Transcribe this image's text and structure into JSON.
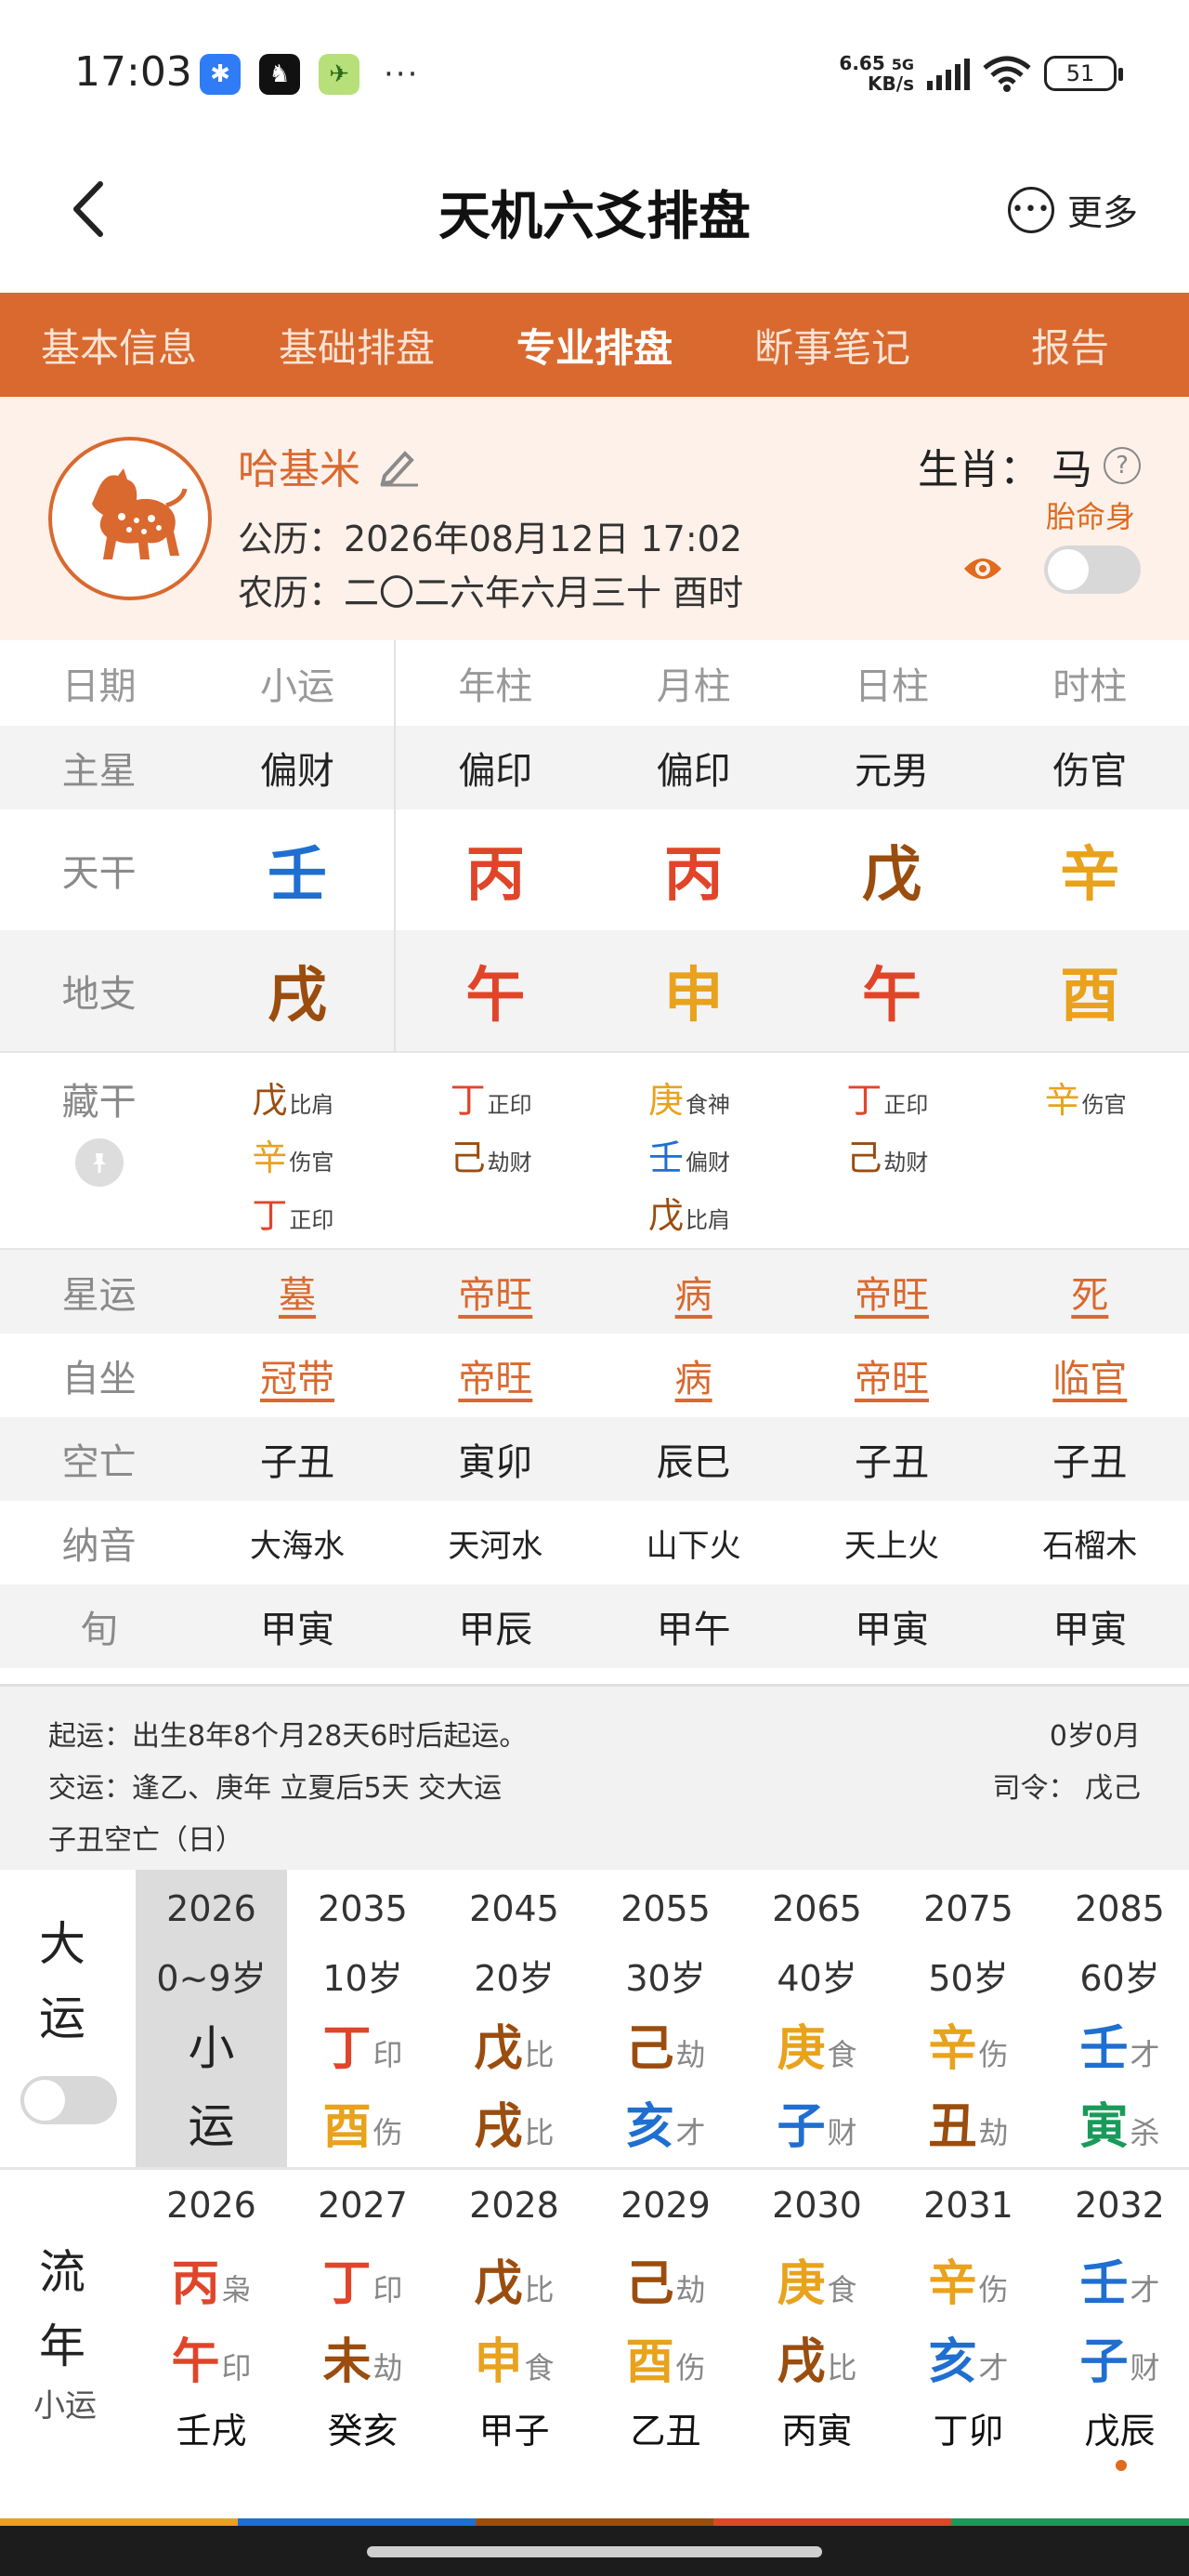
{
  "status_bar": {
    "time": "17:03",
    "dots": "···",
    "speed_top": "6.65",
    "speed_net": "5G",
    "speed_unit": "KB/s",
    "battery": "51"
  },
  "header": {
    "title": "天机六爻排盘",
    "more": "更多",
    "more_icon": "dots-circle-icon"
  },
  "tabs": [
    {
      "label": "基本信息",
      "active": false
    },
    {
      "label": "基础排盘",
      "active": false
    },
    {
      "label": "专业排盘",
      "active": true
    },
    {
      "label": "断事笔记",
      "active": false
    },
    {
      "label": "报告",
      "active": false
    }
  ],
  "profile": {
    "name": "哈基米",
    "solar": "公历：2026年08月12日 17:02",
    "lunar": "农历：二〇二六年六月三十 酉时",
    "zodiac_label": "生肖：",
    "zodiac": "马",
    "help_icon": "?",
    "taiming": "胎命身"
  },
  "grid": {
    "headers": [
      "日期",
      "小运",
      "年柱",
      "月柱",
      "日柱",
      "时柱"
    ],
    "zhuxing": [
      "主星",
      "偏财",
      "偏印",
      "偏印",
      "元男",
      "伤官"
    ],
    "tiangan_label": "天干",
    "tiangan": [
      {
        "char": "壬",
        "color": "#1f6fd1"
      },
      {
        "char": "丙",
        "color": "#e0452a"
      },
      {
        "char": "丙",
        "color": "#e0452a"
      },
      {
        "char": "戊",
        "color": "#9a4d0e"
      },
      {
        "char": "辛",
        "color": "#e8a21c"
      }
    ],
    "dizhi_label": "地支",
    "dizhi": [
      {
        "char": "戌",
        "color": "#9a4d0e"
      },
      {
        "char": "午",
        "color": "#e0452a"
      },
      {
        "char": "申",
        "color": "#e8a21c"
      },
      {
        "char": "午",
        "color": "#e0452a"
      },
      {
        "char": "酉",
        "color": "#e8a21c"
      }
    ],
    "canggan_label": "藏干",
    "canggan": [
      [
        {
          "char": "戊",
          "tag": "比肩",
          "color": "#9a4d0e"
        },
        {
          "char": "辛",
          "tag": "伤官",
          "color": "#e8a21c"
        },
        {
          "char": "丁",
          "tag": "正印",
          "color": "#e0452a"
        }
      ],
      [
        {
          "char": "丁",
          "tag": "正印",
          "color": "#e0452a"
        },
        {
          "char": "己",
          "tag": "劫财",
          "color": "#9a4d0e"
        }
      ],
      [
        {
          "char": "庚",
          "tag": "食神",
          "color": "#e8a21c"
        },
        {
          "char": "壬",
          "tag": "偏财",
          "color": "#1f6fd1"
        },
        {
          "char": "戊",
          "tag": "比肩",
          "color": "#9a4d0e"
        }
      ],
      [
        {
          "char": "丁",
          "tag": "正印",
          "color": "#e0452a"
        },
        {
          "char": "己",
          "tag": "劫财",
          "color": "#9a4d0e"
        }
      ],
      [
        {
          "char": "辛",
          "tag": "伤官",
          "color": "#e8a21c"
        }
      ]
    ],
    "xingyun": [
      "星运",
      "墓",
      "帝旺",
      "病",
      "帝旺",
      "死"
    ],
    "zizuo": [
      "自坐",
      "冠带",
      "帝旺",
      "病",
      "帝旺",
      "临官"
    ],
    "kongwang": [
      "空亡",
      "子丑",
      "寅卯",
      "辰巳",
      "子丑",
      "子丑"
    ],
    "nayin": [
      "纳音",
      "大海水",
      "天河水",
      "山下火",
      "天上火",
      "石榴木"
    ],
    "xun": [
      "旬",
      "甲寅",
      "甲辰",
      "甲午",
      "甲寅",
      "甲寅"
    ]
  },
  "info": {
    "qiyun": "起运：出生8年8个月28天6时后起运。",
    "age": "0岁0月",
    "jiaoyun": "交运：逢乙、庚年 立夏后5天 交大运",
    "siling": "司令：  戊己",
    "kongwang": "子丑空亡（日）"
  },
  "dayun": {
    "label_top": "大",
    "label_bottom": "运",
    "current": {
      "year": "2026",
      "age": "0~9岁",
      "line1": "小",
      "line2": "运"
    },
    "items": [
      {
        "year": "2035",
        "age": "10岁",
        "gan": "丁",
        "gan_tag": "印",
        "gan_color": "#e0452a",
        "zhi": "酉",
        "zhi_tag": "伤",
        "zhi_color": "#e8a21c"
      },
      {
        "year": "2045",
        "age": "20岁",
        "gan": "戊",
        "gan_tag": "比",
        "gan_color": "#9a4d0e",
        "zhi": "戌",
        "zhi_tag": "比",
        "zhi_color": "#9a4d0e"
      },
      {
        "year": "2055",
        "age": "30岁",
        "gan": "己",
        "gan_tag": "劫",
        "gan_color": "#9a4d0e",
        "zhi": "亥",
        "zhi_tag": "才",
        "zhi_color": "#1f6fd1"
      },
      {
        "year": "2065",
        "age": "40岁",
        "gan": "庚",
        "gan_tag": "食",
        "gan_color": "#e8a21c",
        "zhi": "子",
        "zhi_tag": "财",
        "zhi_color": "#1f6fd1"
      },
      {
        "year": "2075",
        "age": "50岁",
        "gan": "辛",
        "gan_tag": "伤",
        "gan_color": "#e8a21c",
        "zhi": "丑",
        "zhi_tag": "劫",
        "zhi_color": "#9a4d0e"
      },
      {
        "year": "2085",
        "age": "60岁",
        "gan": "壬",
        "gan_tag": "才",
        "gan_color": "#1f6fd1",
        "zhi": "寅",
        "zhi_tag": "杀",
        "zhi_color": "#1a9a5a"
      }
    ]
  },
  "liunian": {
    "label_top": "流",
    "label_bottom": "年",
    "label_small": "小运",
    "items": [
      {
        "year": "2026",
        "gan": "丙",
        "gan_tag": "枭",
        "gan_color": "#e0452a",
        "zhi": "午",
        "zhi_tag": "印",
        "zhi_color": "#e0452a",
        "xiaoyun": "壬戌"
      },
      {
        "year": "2027",
        "gan": "丁",
        "gan_tag": "印",
        "gan_color": "#e0452a",
        "zhi": "未",
        "zhi_tag": "劫",
        "zhi_color": "#9a4d0e",
        "xiaoyun": "癸亥"
      },
      {
        "year": "2028",
        "gan": "戊",
        "gan_tag": "比",
        "gan_color": "#9a4d0e",
        "zhi": "申",
        "zhi_tag": "食",
        "zhi_color": "#e8a21c",
        "xiaoyun": "甲子"
      },
      {
        "year": "2029",
        "gan": "己",
        "gan_tag": "劫",
        "gan_color": "#9a4d0e",
        "zhi": "酉",
        "zhi_tag": "伤",
        "zhi_color": "#e8a21c",
        "xiaoyun": "乙丑"
      },
      {
        "year": "2030",
        "gan": "庚",
        "gan_tag": "食",
        "gan_color": "#e8a21c",
        "zhi": "戌",
        "zhi_tag": "比",
        "zhi_color": "#9a4d0e",
        "xiaoyun": "丙寅"
      },
      {
        "year": "2031",
        "gan": "辛",
        "gan_tag": "伤",
        "gan_color": "#e8a21c",
        "zhi": "亥",
        "zhi_tag": "才",
        "zhi_color": "#1f6fd1",
        "xiaoyun": "丁卯"
      },
      {
        "year": "2032",
        "gan": "壬",
        "gan_tag": "才",
        "gan_color": "#1f6fd1",
        "zhi": "子",
        "zhi_tag": "财",
        "zhi_color": "#1f6fd1",
        "xiaoyun": "戊辰"
      }
    ]
  },
  "colors": {
    "accent": "#d9692f",
    "wood": "#1a9a5a",
    "fire": "#e0452a",
    "earth": "#9a4d0e",
    "metal": "#e8a21c",
    "water": "#1f6fd1"
  }
}
